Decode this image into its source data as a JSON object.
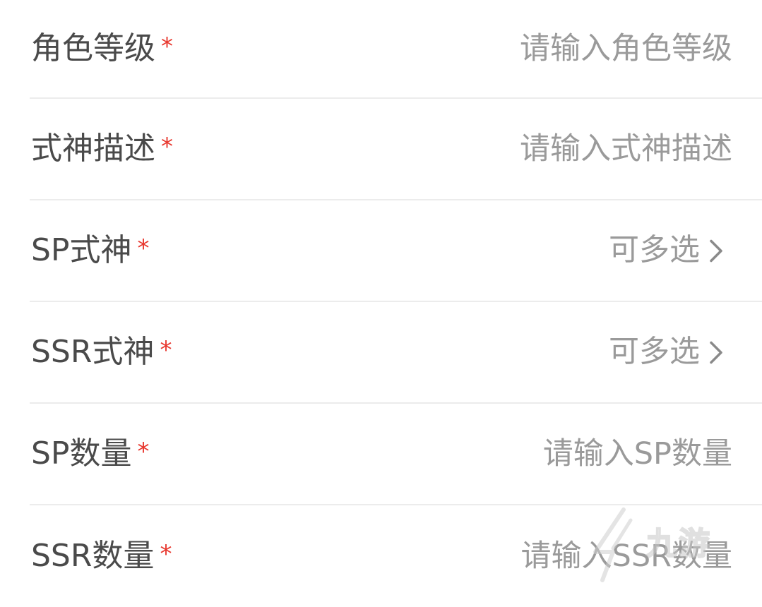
{
  "form": {
    "rows": [
      {
        "label": "角色等级",
        "required_mark": "*",
        "placeholder": "请输入角色等级"
      },
      {
        "label": "式神描述",
        "required_mark": "*",
        "placeholder": "请输入式神描述"
      },
      {
        "label": "SP式神",
        "required_mark": "*",
        "select_text": "可多选"
      },
      {
        "label": "SSR式神",
        "required_mark": "*",
        "select_text": "可多选"
      },
      {
        "label": "SP数量",
        "required_mark": "*",
        "placeholder": "请输入SP数量"
      },
      {
        "label": "SSR数量",
        "required_mark": "*",
        "placeholder": "请输入SSR数量"
      }
    ]
  },
  "watermark": {
    "text": "九游"
  },
  "colors": {
    "label": "#4a4a4a",
    "placeholder": "#9a9a9a",
    "required": "#e8382f",
    "divider": "#ececec",
    "background": "#ffffff"
  },
  "icons": {
    "chevron": "chevron-right-icon",
    "watermark_logo": "watermark-logo-icon"
  }
}
